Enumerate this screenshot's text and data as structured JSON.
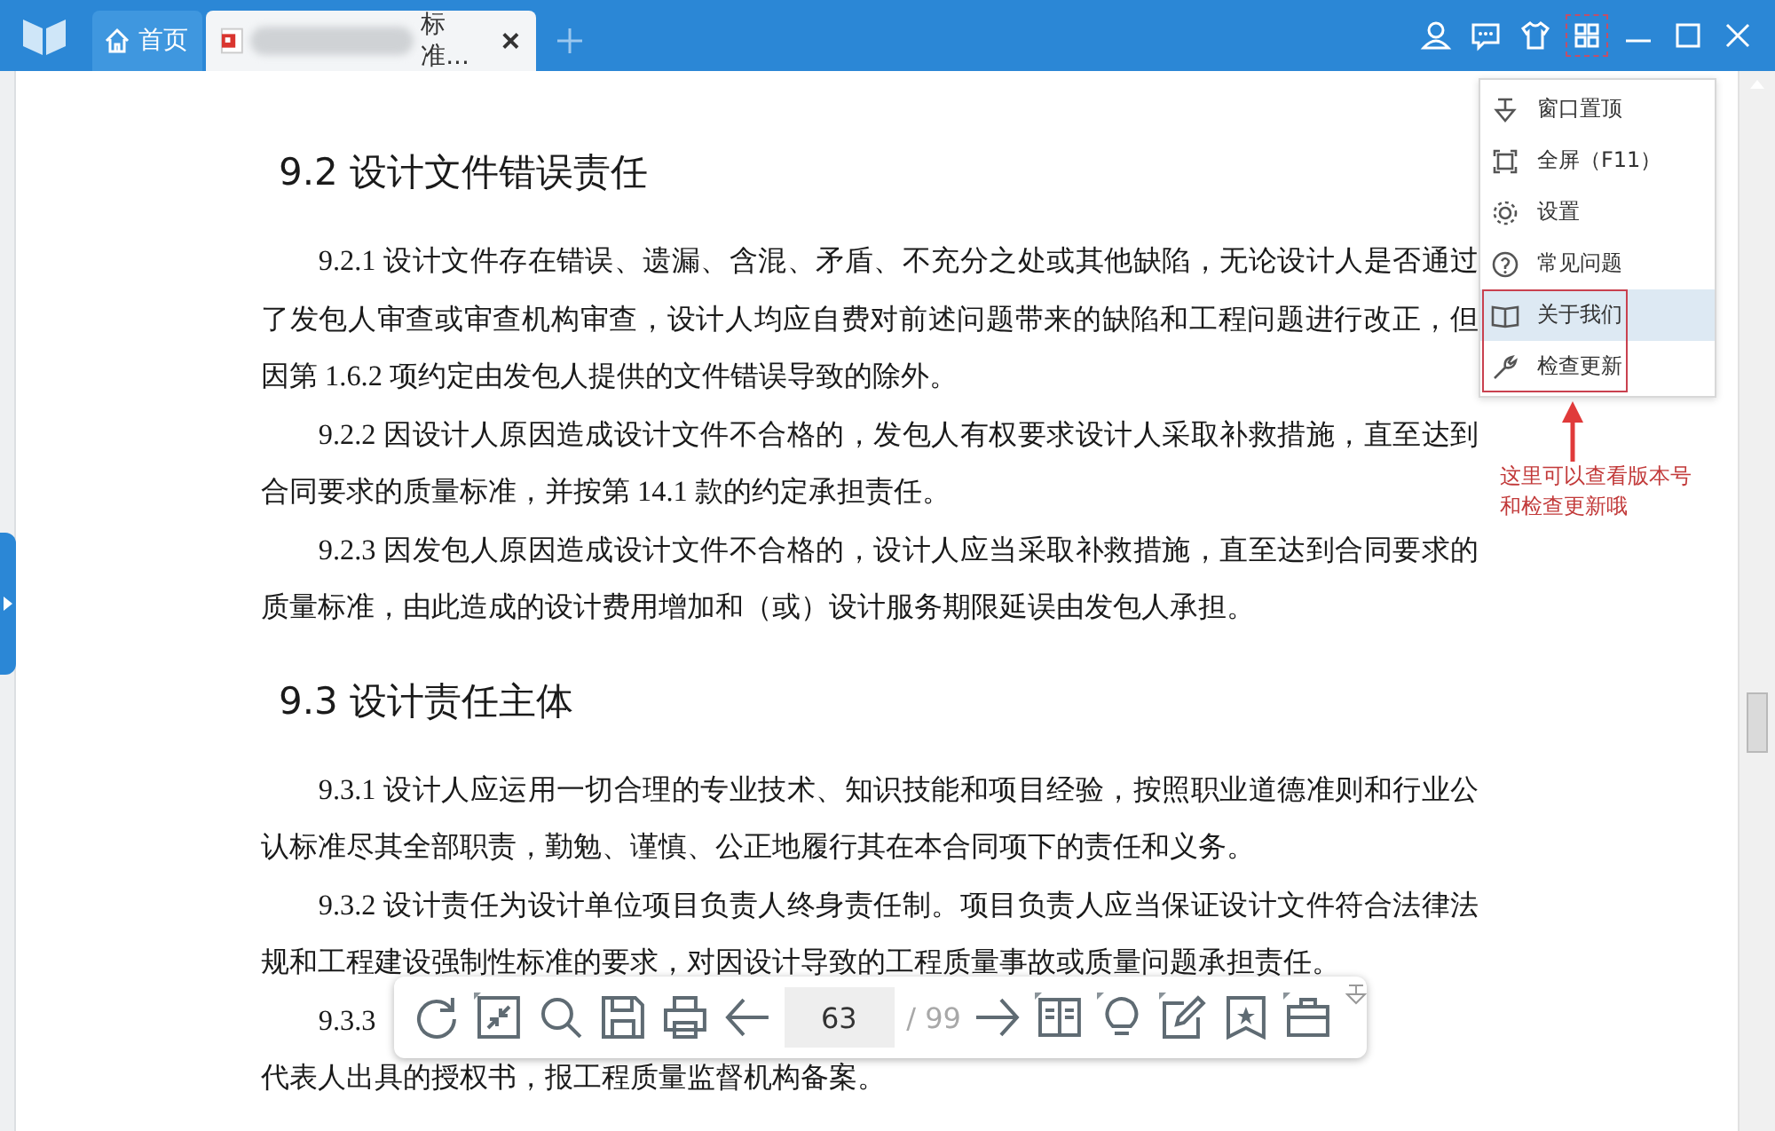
{
  "tabs": [
    {
      "kind": "home",
      "label": "首页",
      "selected": false
    },
    {
      "kind": "document",
      "label": "标准...",
      "selected": true
    }
  ],
  "document": {
    "blocks": [
      {
        "kind": "heading",
        "text": "9.2  设计文件错误责任"
      },
      {
        "kind": "paragraph",
        "text": "9.2.1  设计文件存在错误、遗漏、含混、矛盾、不充分之处或其他缺陷，无论设计人是否通过了发包人审查或审查机构审查，设计人均应自费对前述问题带来的缺陷和工程问题进行改正，但因第 1.6.2 项约定由发包人提供的文件错误导致的除外。"
      },
      {
        "kind": "paragraph",
        "text": "9.2.2  因设计人原因造成设计文件不合格的，发包人有权要求设计人采取补救措施，直至达到合同要求的质量标准，并按第 14.1 款的约定承担责任。"
      },
      {
        "kind": "paragraph",
        "text": "9.2.3  因发包人原因造成设计文件不合格的，设计人应当采取补救措施，直至达到合同要求的质量标准，由此造成的设计费用增加和（或）设计服务期限延误由发包人承担。"
      },
      {
        "kind": "heading",
        "text": "9.3  设计责任主体"
      },
      {
        "kind": "paragraph",
        "text": "9.3.1  设计人应运用一切合理的专业技术、知识技能和项目经验，按照职业道德准则和行业公认标准尽其全部职责，勤勉、谨慎、公正地履行其在本合同项下的责任和义务。"
      },
      {
        "kind": "paragraph",
        "text": "9.3.2  设计责任为设计单位项目负责人终身责任制。项目负责人应当保证设计文件符合法律法规和工程建设强制性标准的要求，对因设计导致的工程质量事故或质量问题承担责任。"
      },
      {
        "kind": "paragraph",
        "text": "9.3.3"
      },
      {
        "kind": "line",
        "text": "代表人出具的授权书，报工程质量监督机构备案。"
      }
    ]
  },
  "menu": {
    "items": [
      {
        "label": "窗口置顶",
        "selected": false
      },
      {
        "label": "全屏（F11）",
        "selected": false
      },
      {
        "label": "设置",
        "selected": false
      },
      {
        "label": "常见问题",
        "selected": false
      },
      {
        "label": "关于我们",
        "selected": true
      },
      {
        "label": "检查更新",
        "selected": false
      }
    ]
  },
  "annotation": {
    "lines": [
      "这里可以查看版本号",
      "和检查更新哦"
    ]
  },
  "toolbar": {
    "page": "63",
    "total": "/ 99"
  }
}
